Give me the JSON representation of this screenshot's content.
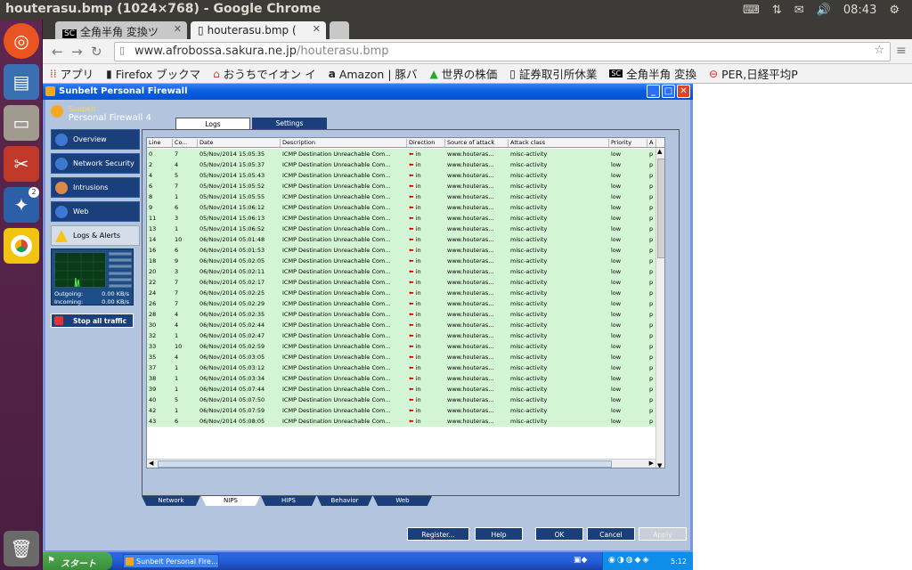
{
  "topbar": {
    "title": "houterasu.bmp (1024×768) - Google Chrome",
    "time": "08:43",
    "tray_icons": [
      "keyboard-icon",
      "network-icon",
      "mail-icon",
      "volume-icon"
    ]
  },
  "launcher": {
    "badge": "2"
  },
  "chrome": {
    "tabs": [
      {
        "label": "全角半角 変換ツ"
      },
      {
        "label": "houterasu.bmp ("
      }
    ],
    "url_host": "www.afrobossa.sakura.ne.jp",
    "url_path": "/houterasu.bmp",
    "bookmarks": [
      {
        "label": "アプリ",
        "icon": "apps-icon"
      },
      {
        "label": "Firefox ブックマ",
        "icon": "folder-icon"
      },
      {
        "label": "おうちでイオン イ",
        "icon": "home-icon"
      },
      {
        "label": "Amazon | 豚バ",
        "icon": "amazon-icon"
      },
      {
        "label": "世界の株価",
        "icon": "chart-icon"
      },
      {
        "label": "証券取引所休業",
        "icon": "page-icon"
      },
      {
        "label": "全角半角 変換",
        "icon": "sc-icon"
      },
      {
        "label": "PER,日経平均P",
        "icon": "red-circle-icon"
      }
    ]
  },
  "app": {
    "title": "Sunbelt Personal Firewall",
    "brand_small": "Sunbelt",
    "brand_name": "Personal Firewall 4",
    "sidebar": [
      {
        "label": "Overview"
      },
      {
        "label": "Network Security"
      },
      {
        "label": "Intrusions"
      },
      {
        "label": "Web"
      },
      {
        "label": "Logs & Alerts"
      }
    ],
    "monitor": {
      "outgoing_label": "Outgoing:",
      "outgoing_value": "0.00 KB/s",
      "incoming_label": "Incoming:",
      "incoming_value": "0.00 KB/s"
    },
    "stop_label": "Stop all traffic",
    "top_tabs": [
      {
        "label": "Logs"
      },
      {
        "label": "Settings"
      }
    ],
    "columns": [
      "Line",
      "Co...",
      "Date",
      "Description",
      "Direction",
      "Source of attack",
      "Attack class",
      "Priority",
      "A"
    ],
    "rows": [
      [
        "0",
        "7",
        "05/Nov/2014 15:05:35",
        "ICMP Destination Unreachable Com...",
        "in",
        "www.houteras...",
        "misc-activity",
        "low",
        "p"
      ],
      [
        "2",
        "4",
        "05/Nov/2014 15:05:37",
        "ICMP Destination Unreachable Com...",
        "in",
        "www.houteras...",
        "misc-activity",
        "low",
        "p"
      ],
      [
        "4",
        "5",
        "05/Nov/2014 15:05:43",
        "ICMP Destination Unreachable Com...",
        "in",
        "www.houteras...",
        "misc-activity",
        "low",
        "p"
      ],
      [
        "6",
        "7",
        "05/Nov/2014 15:05:52",
        "ICMP Destination Unreachable Com...",
        "in",
        "www.houteras...",
        "misc-activity",
        "low",
        "p"
      ],
      [
        "8",
        "1",
        "05/Nov/2014 15:05:55",
        "ICMP Destination Unreachable Com...",
        "in",
        "www.houteras...",
        "misc-activity",
        "low",
        "p"
      ],
      [
        "9",
        "6",
        "05/Nov/2014 15:06:12",
        "ICMP Destination Unreachable Com...",
        "in",
        "www.houteras...",
        "misc-activity",
        "low",
        "p"
      ],
      [
        "11",
        "3",
        "05/Nov/2014 15:06:13",
        "ICMP Destination Unreachable Com...",
        "in",
        "www.houteras...",
        "misc-activity",
        "low",
        "p"
      ],
      [
        "13",
        "1",
        "05/Nov/2014 15:06:52",
        "ICMP Destination Unreachable Com...",
        "in",
        "www.houteras...",
        "misc-activity",
        "low",
        "p"
      ],
      [
        "14",
        "10",
        "06/Nov/2014 05:01:48",
        "ICMP Destination Unreachable Com...",
        "in",
        "www.houteras...",
        "misc-activity",
        "low",
        "p"
      ],
      [
        "16",
        "6",
        "06/Nov/2014 05:01:53",
        "ICMP Destination Unreachable Com...",
        "in",
        "www.houteras...",
        "misc-activity",
        "low",
        "p"
      ],
      [
        "18",
        "9",
        "06/Nov/2014 05:02:05",
        "ICMP Destination Unreachable Com...",
        "in",
        "www.houteras...",
        "misc-activity",
        "low",
        "p"
      ],
      [
        "20",
        "3",
        "06/Nov/2014 05:02:11",
        "ICMP Destination Unreachable Com...",
        "in",
        "www.houteras...",
        "misc-activity",
        "low",
        "p"
      ],
      [
        "22",
        "7",
        "06/Nov/2014 05:02:17",
        "ICMP Destination Unreachable Com...",
        "in",
        "www.houteras...",
        "misc-activity",
        "low",
        "p"
      ],
      [
        "24",
        "7",
        "06/Nov/2014 05:02:25",
        "ICMP Destination Unreachable Com...",
        "in",
        "www.houteras...",
        "misc-activity",
        "low",
        "p"
      ],
      [
        "26",
        "7",
        "06/Nov/2014 05:02:29",
        "ICMP Destination Unreachable Com...",
        "in",
        "www.houteras...",
        "misc-activity",
        "low",
        "p"
      ],
      [
        "28",
        "4",
        "06/Nov/2014 05:02:35",
        "ICMP Destination Unreachable Com...",
        "in",
        "www.houteras...",
        "misc-activity",
        "low",
        "p"
      ],
      [
        "30",
        "4",
        "06/Nov/2014 05:02:44",
        "ICMP Destination Unreachable Com...",
        "in",
        "www.houteras...",
        "misc-activity",
        "low",
        "p"
      ],
      [
        "32",
        "1",
        "06/Nov/2014 05:02:47",
        "ICMP Destination Unreachable Com...",
        "in",
        "www.houteras...",
        "misc-activity",
        "low",
        "p"
      ],
      [
        "33",
        "10",
        "06/Nov/2014 05:02:59",
        "ICMP Destination Unreachable Com...",
        "in",
        "www.houteras...",
        "misc-activity",
        "low",
        "p"
      ],
      [
        "35",
        "4",
        "06/Nov/2014 05:03:05",
        "ICMP Destination Unreachable Com...",
        "in",
        "www.houteras...",
        "misc-activity",
        "low",
        "p"
      ],
      [
        "37",
        "1",
        "06/Nov/2014 05:03:12",
        "ICMP Destination Unreachable Com...",
        "in",
        "www.houteras...",
        "misc-activity",
        "low",
        "p"
      ],
      [
        "38",
        "1",
        "06/Nov/2014 05:03:34",
        "ICMP Destination Unreachable Com...",
        "in",
        "www.houteras...",
        "misc-activity",
        "low",
        "p"
      ],
      [
        "39",
        "1",
        "06/Nov/2014 05:07:44",
        "ICMP Destination Unreachable Com...",
        "in",
        "www.houteras...",
        "misc-activity",
        "low",
        "p"
      ],
      [
        "40",
        "5",
        "06/Nov/2014 05:07:50",
        "ICMP Destination Unreachable Com...",
        "in",
        "www.houteras...",
        "misc-activity",
        "low",
        "p"
      ],
      [
        "42",
        "1",
        "06/Nov/2014 05:07:59",
        "ICMP Destination Unreachable Com...",
        "in",
        "www.houteras...",
        "misc-activity",
        "low",
        "p"
      ],
      [
        "43",
        "6",
        "06/Nov/2014 05:08:05",
        "ICMP Destination Unreachable Com...",
        "in",
        "www.houteras...",
        "misc-activity",
        "low",
        "p"
      ]
    ],
    "bottom_tabs": [
      {
        "label": "Network"
      },
      {
        "label": "NIPS"
      },
      {
        "label": "HIPS"
      },
      {
        "label": "Behavior"
      },
      {
        "label": "Web"
      }
    ],
    "footer_buttons": [
      {
        "label": "Register..."
      },
      {
        "label": "Help"
      },
      {
        "label": "OK"
      },
      {
        "label": "Cancel"
      },
      {
        "label": "Apply"
      }
    ]
  },
  "xp_taskbar": {
    "start_label": "スタート",
    "task_label": "Sunbelt Personal Fire...",
    "clock": "5:12"
  },
  "colors": {
    "row_bg": "#d4f5d4",
    "sidebar_bg": "#1a3f7a",
    "arrow": "#cc0000"
  }
}
